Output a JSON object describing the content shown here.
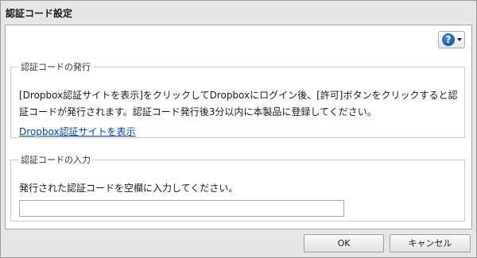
{
  "dialog": {
    "title": "認証コード設定"
  },
  "help": {
    "icon_glyph": "?"
  },
  "issue_section": {
    "legend": "認証コードの発行",
    "instructions": "[Dropbox認証サイトを表示]をクリックしてDropboxにログイン後、[許可]ボタンをクリックすると認証コードが発行されます。認証コード発行後3分以内に本製品に登録してください。",
    "link_label": "Dropbox認証サイトを表示"
  },
  "input_section": {
    "legend": "認証コードの入力",
    "instructions": "発行された認証コードを空欄に入力してください。",
    "code_value": ""
  },
  "buttons": {
    "ok_label": "OK",
    "cancel_label": "キャンセル"
  }
}
